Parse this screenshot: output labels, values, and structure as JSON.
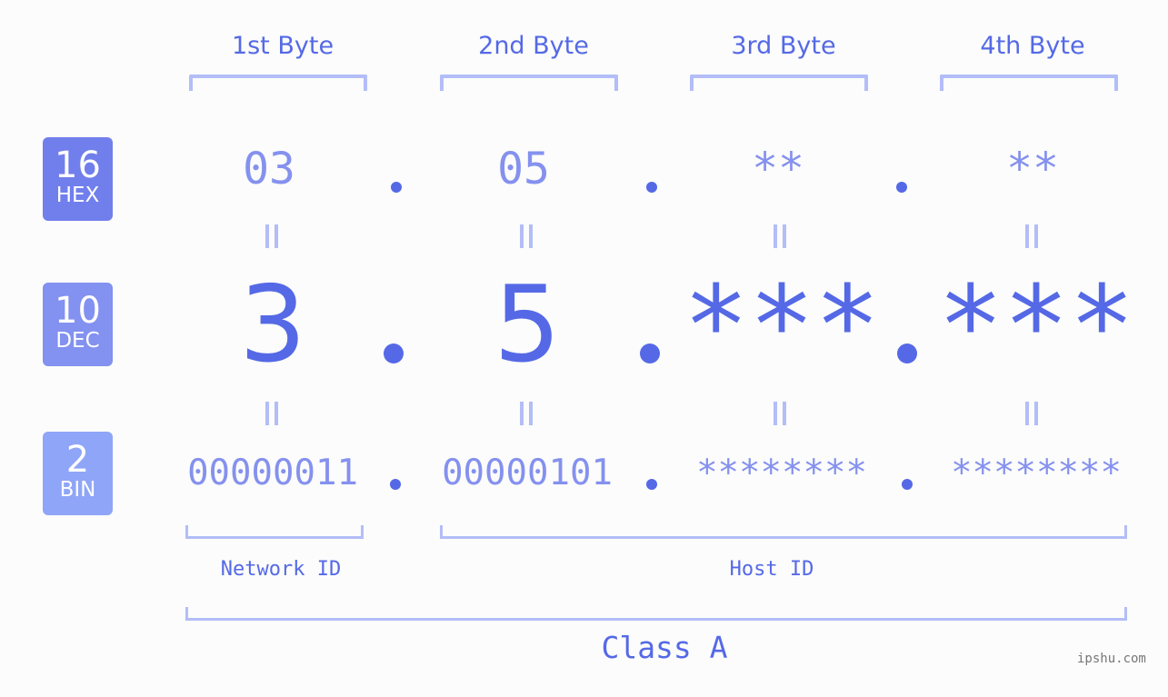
{
  "header": {
    "bytes": [
      "1st Byte",
      "2nd Byte",
      "3rd Byte",
      "4th Byte"
    ]
  },
  "badges": {
    "hex": {
      "number": "16",
      "label": "HEX",
      "color": "#717fec"
    },
    "dec": {
      "number": "10",
      "label": "DEC",
      "color": "#8391f0"
    },
    "bin": {
      "number": "2",
      "label": "BIN",
      "color": "#8fa5f7"
    }
  },
  "rows": {
    "hex": [
      "03",
      "05",
      "**",
      "**"
    ],
    "dec": [
      "3",
      "5",
      "***",
      "***"
    ],
    "bin": [
      "00000011",
      "00000101",
      "********",
      "********"
    ]
  },
  "separator": ".",
  "sections": {
    "network_id": "Network ID",
    "host_id": "Host ID",
    "class": "Class A"
  },
  "colors": {
    "accent": "#5569e6",
    "light_accent": "#8591ee",
    "bracket": "#b3bdf7",
    "background": "#fbfcfb"
  },
  "watermark": "ipshu.com"
}
